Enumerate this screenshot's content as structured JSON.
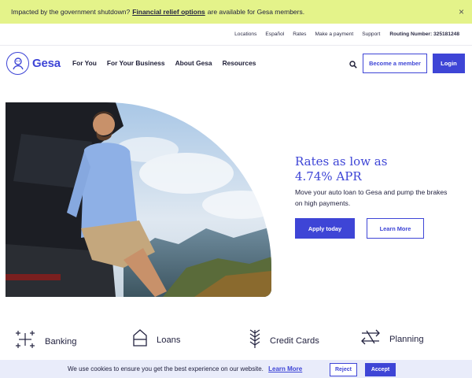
{
  "alert": {
    "prefix": "Impacted by the government shutdown?",
    "link": "Financial relief options",
    "suffix": "are available for Gesa members.",
    "close": "×"
  },
  "utility": {
    "links": [
      "Locations",
      "Español",
      "Rates",
      "Make a payment",
      "Support"
    ],
    "routing": "Routing Number: 325181248"
  },
  "nav": {
    "logo_text": "Gesa",
    "menu": [
      "For You",
      "For Your Business",
      "About Gesa",
      "Resources"
    ],
    "member_button": "Become a member",
    "login_button": "Login"
  },
  "hero": {
    "title_line1": "Rates as low as",
    "title_line2": "4.74% APR",
    "subtitle": "Move your auto loan to Gesa and pump the brakes on high payments.",
    "primary_button": "Apply today",
    "secondary_button": "Learn More"
  },
  "categories": [
    {
      "label": "Banking",
      "icon": "sparkle-icon"
    },
    {
      "label": "Loans",
      "icon": "house-icon"
    },
    {
      "label": "Credit Cards",
      "icon": "wheat-icon"
    },
    {
      "label": "Planning",
      "icon": "arrows-icon"
    }
  ],
  "cookie": {
    "text": "We use cookies to ensure you get the best experience on our website.",
    "link": "Learn More",
    "reject": "Reject",
    "accept": "Accept"
  },
  "colors": {
    "brand": "#3e45d6",
    "alert_bg": "#e4f38a",
    "cookie_bg": "#e9ecfa"
  }
}
